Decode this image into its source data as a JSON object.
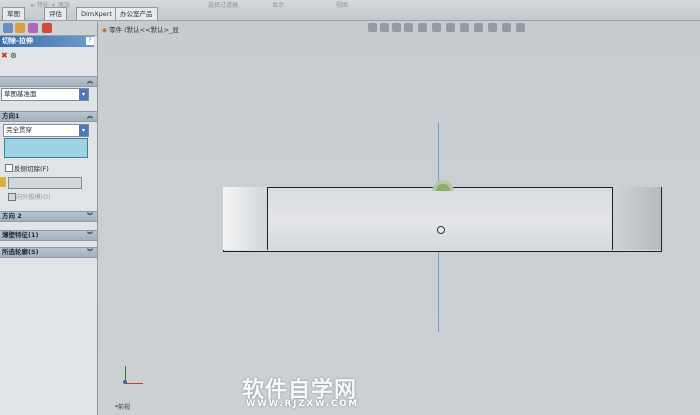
{
  "tabs": [
    "草图",
    "评估",
    "DimXpert",
    "办公室产品"
  ],
  "toolbar_top": {
    "label_a": "选择过滤器",
    "label_b": "显示",
    "label_c": "视图"
  },
  "property_manager": {
    "title": "切除-拉伸",
    "help_glyph": "?",
    "from_select": "草图基准面",
    "direction1_section": "方向1",
    "end_condition_select": "完全贯穿",
    "flip_side_label": "反侧切除(F)",
    "draft_label": "向外拔模(O)",
    "direction2_section": "方向 2",
    "thin_feature_section": "薄壁特征(1)",
    "selected_contours_section": "所选轮廓(S)"
  },
  "graphics": {
    "breadcrumb": "零件 (默认<<默认>_显"
  },
  "status": {
    "view_label": "*前视"
  },
  "watermark": {
    "cn": "软件自学网",
    "url": "WWW.RJZXW.COM"
  },
  "colors": {
    "accent_title": "#3a6ea8",
    "origin_axis": "#5f8fd0",
    "triad_x": "#c43a3a",
    "triad_y": "#2c7d2c"
  }
}
